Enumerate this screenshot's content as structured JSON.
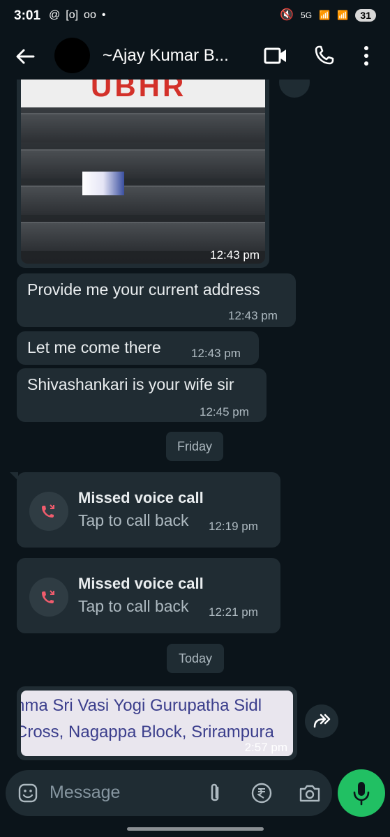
{
  "status_bar": {
    "time": "3:01",
    "left_icons": [
      "@",
      "[o]",
      "oo",
      "•"
    ],
    "right_icons": [
      "🔇",
      "5G",
      "📶",
      "📶"
    ],
    "battery": "31"
  },
  "header": {
    "contact_name": "~Ajay Kumar B...",
    "icons": [
      "back-arrow-icon",
      "video-call-icon",
      "voice-call-icon",
      "more-options-icon"
    ]
  },
  "messages": [
    {
      "type": "image",
      "time": "12:43 pm",
      "sign_text": "UBHR"
    },
    {
      "type": "text",
      "text": "Provide me your current address",
      "time": "12:43 pm"
    },
    {
      "type": "text",
      "text": "Let me come there",
      "time": "12:43 pm"
    },
    {
      "type": "text",
      "text": "Shivashankari is your wife sir",
      "time": "12:45 pm"
    }
  ],
  "date_chips": {
    "friday": "Friday",
    "today": "Today"
  },
  "calls": [
    {
      "title": "Missed voice call",
      "subtitle": "Tap to call back",
      "time": "12:19 pm"
    },
    {
      "title": "Missed voice call",
      "subtitle": "Tap to call back",
      "time": "12:21 pm"
    }
  ],
  "document": {
    "line1": "hma Sri Vasi Yogi Gurupatha Sidl",
    "line2": "Cross, Nagappa Block, Srirampura",
    "time": "2:57 pm"
  },
  "composer": {
    "placeholder": "Message",
    "icons": [
      "emoji-icon",
      "attach-icon",
      "rupee-icon",
      "camera-icon",
      "mic-icon"
    ]
  },
  "colors": {
    "background": "#0b141a",
    "bubble": "#202c33",
    "accent_green": "#21c063",
    "missed_call_red": "#f15c6d"
  }
}
